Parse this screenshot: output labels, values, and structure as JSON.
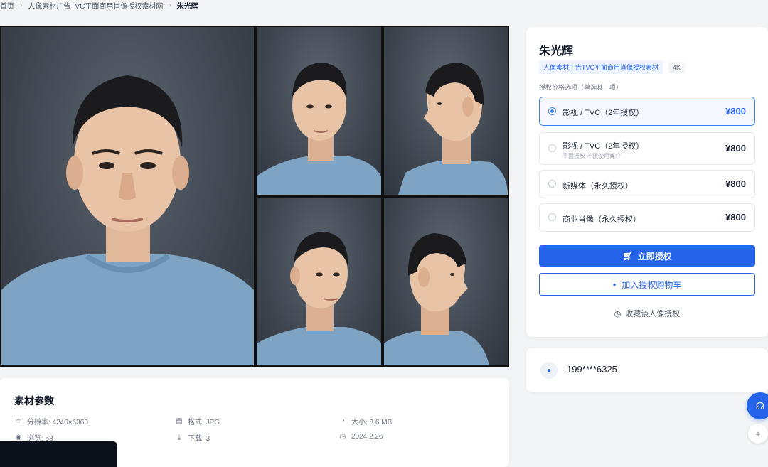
{
  "breadcrumb": {
    "items": [
      "首页",
      "人像素材广告TVC平面商用肖像授权素材网",
      "朱光辉"
    ]
  },
  "gallery": {
    "shirt_color": "#7fa3c2",
    "background_color": "#3f4650"
  },
  "params": {
    "title": "素材参数",
    "items": [
      {
        "icon": "resolution-icon",
        "text": "分辨率: 4240×6360"
      },
      {
        "icon": "format-icon",
        "text": "格式: JPG"
      },
      {
        "icon": "size-icon",
        "text": "大小: 8.6 MB"
      },
      {
        "icon": "views-icon",
        "text": "浏览: 58"
      },
      {
        "icon": "download-icon",
        "text": "下载: 3"
      },
      {
        "icon": "date-icon",
        "text": "2024.2.26"
      }
    ]
  },
  "panel": {
    "name": "朱光辉",
    "tags": [
      "人像素材广告TVC平面商用肖像授权素材",
      "4K"
    ],
    "options_title": "授权价格选项（单选其一项）",
    "options": [
      {
        "label": "影视 / TVC（2年授权）",
        "sub": "",
        "price": "¥800",
        "selected": true
      },
      {
        "label": "影视 / TVC（2年授权）",
        "sub": "平面授权 不限使用媒介",
        "price": "¥800",
        "selected": false
      },
      {
        "label": "新媒体（永久授权）",
        "sub": "",
        "price": "¥800",
        "selected": false
      },
      {
        "label": "商业肖像（永久授权）",
        "sub": "",
        "price": "¥800",
        "selected": false
      }
    ],
    "buy_label": "立即授权",
    "cart_label": "加入授权购物车",
    "favorite_label": "收藏该人像授权"
  },
  "contact": {
    "phone": "199****6325"
  },
  "colors": {
    "accent": "#2563eb",
    "page_bg": "#f3f4f6"
  }
}
